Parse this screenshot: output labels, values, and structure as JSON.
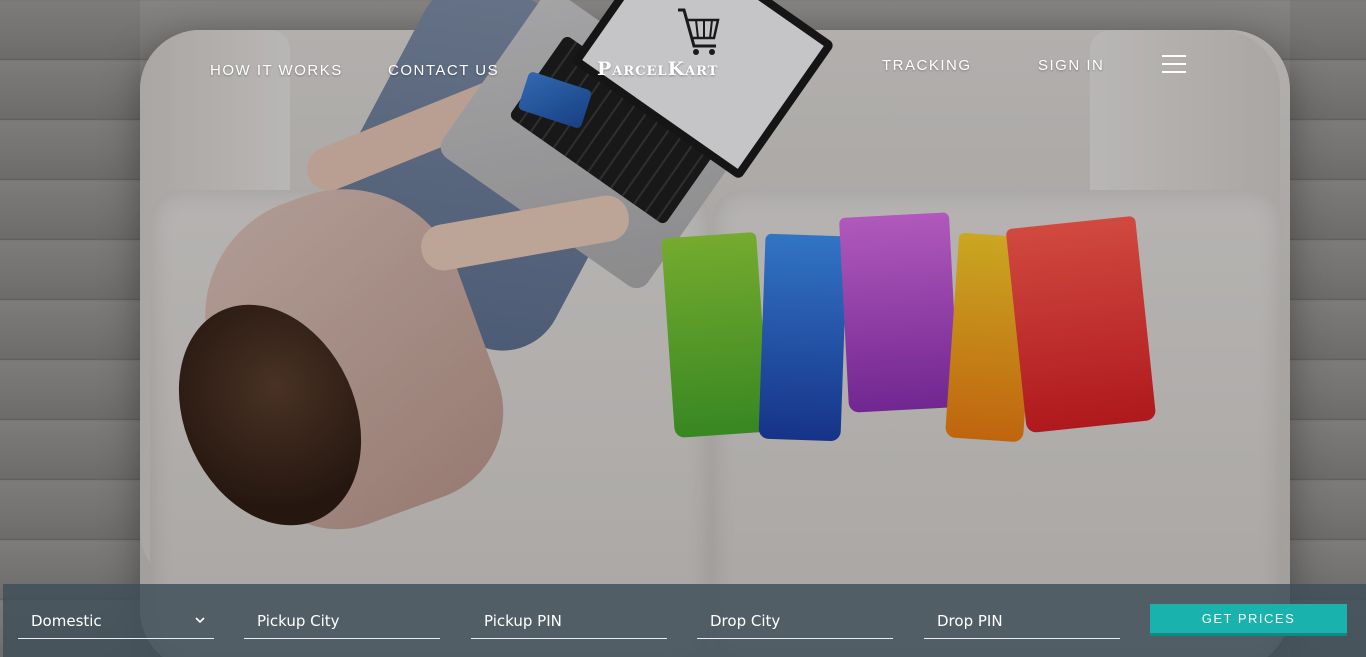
{
  "brand": {
    "logo_text": "ParcelKart"
  },
  "nav": {
    "how_it_works": "HOW IT WORKS",
    "contact_us": "CONTACT US",
    "tracking": "TRACKING",
    "sign_in": "SIGN IN",
    "menu_icon": "hamburger-menu-icon"
  },
  "search": {
    "shipment_type": {
      "selected": "Domestic",
      "icon": "chevron-down-icon"
    },
    "pickup_city": {
      "placeholder": "Pickup City"
    },
    "pickup_pin": {
      "placeholder": "Pickup PIN"
    },
    "drop_city": {
      "placeholder": "Drop City"
    },
    "drop_pin": {
      "placeholder": "Drop PIN"
    },
    "submit_label": "GET PRICES"
  },
  "colors": {
    "accent": "#19b2ac",
    "bar_background": "#3e4e58",
    "text": "#ffffff"
  }
}
